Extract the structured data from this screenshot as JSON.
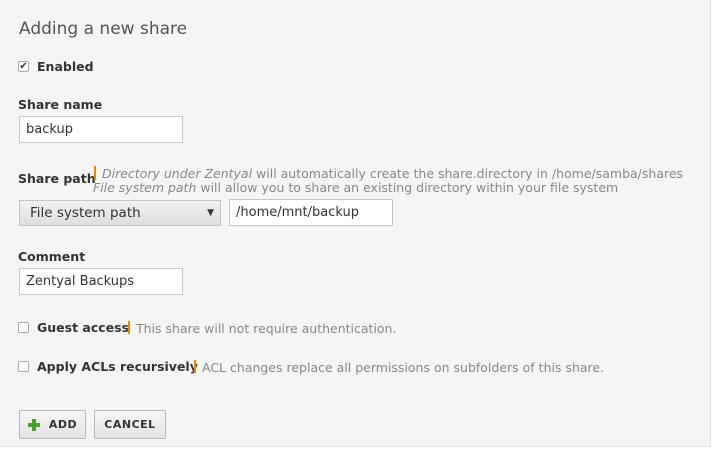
{
  "form": {
    "title": "Adding a new share",
    "enabled": {
      "label": "Enabled",
      "checked": true
    },
    "share_name": {
      "label": "Share name",
      "value": "backup"
    },
    "share_path": {
      "label": "Share path",
      "help_line1_em": "Directory under Zentyal",
      "help_line1_rest": " will automatically create the share.directory in /home/samba/shares",
      "help_line2_em": "File system path",
      "help_line2_rest": " will allow you to share an existing directory within your file system",
      "selected_option": "File system path",
      "path_value": "/home/mnt/backup"
    },
    "comment": {
      "label": "Comment",
      "value": "Zentyal Backups"
    },
    "guest_access": {
      "label": "Guest access",
      "help": "This share will not require authentication.",
      "checked": false
    },
    "apply_acls": {
      "label": "Apply ACLs recursively",
      "help": "ACL changes replace all permissions on subfolders of this share.",
      "checked": false
    },
    "buttons": {
      "add_label": "ADD",
      "cancel_label": "CANCEL"
    }
  },
  "colors": {
    "accent": "#e68a00",
    "add_icon": "#4aa02c",
    "panel_bg": "#f5f5f5"
  }
}
